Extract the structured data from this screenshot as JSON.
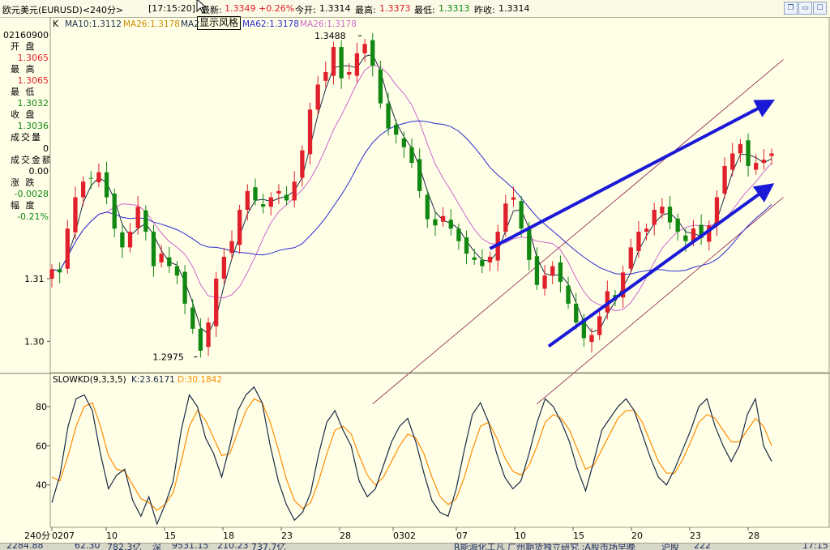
{
  "header": {
    "symbol": "欧元美元(EURUSD)<240分>",
    "time": "[17:15:20]",
    "latest_label": "最新:",
    "latest_value": "1.3349",
    "change_pct": "+0.26%",
    "open_label": "今开:",
    "open_value": "1.3314",
    "high_label": "最高:",
    "high_value": "1.3373",
    "low_label": "最低:",
    "low_value": "1.3313",
    "prev_label": "昨收:",
    "prev_value": "1.3314",
    "window_buttons": [
      "restore-icon",
      "minimize-icon",
      "maximize-icon",
      "close-icon"
    ]
  },
  "tooltip": "显示风格",
  "left_panel": {
    "code": "02160900",
    "rows": [
      {
        "label": "开 盘",
        "value": "1.3065",
        "color": "red"
      },
      {
        "label": "最 高",
        "value": "1.3065",
        "color": "red"
      },
      {
        "label": "最 低",
        "value": "1.3032",
        "color": "green"
      },
      {
        "label": "收 盘",
        "value": "1.3036",
        "color": "green"
      },
      {
        "label": "成交量",
        "value": "0",
        "color": "black"
      },
      {
        "label": "成交金额",
        "value": "0.00",
        "color": "black"
      },
      {
        "label": "涨 跌",
        "value": "-0.0028",
        "color": "green"
      },
      {
        "label": "幅 度",
        "value": "-0.21%",
        "color": "green"
      }
    ]
  },
  "status_bar": {
    "items": [
      "2284.88",
      "62.30",
      "782.3亿",
      "深",
      "9531.15",
      "210.23",
      "737.7亿",
      "R能源化工凡 广州期货独立研究 :A股市场早晚",
      "沪股",
      "222"
    ],
    "time": "17:15"
  },
  "colors": {
    "background": "#ffffe8",
    "up_candle": "#e0202a",
    "down_candle": "#118811",
    "ma10": "#1a2a44",
    "ma26": "#cc66cc",
    "ma62": "#2a2acc",
    "k_line": "#1a2a44",
    "d_line": "#ff8c00",
    "channel_arrow": "#1a1ad6",
    "trend_line": "#8b1a4a"
  },
  "chart_data": [
    {
      "type": "candlestick",
      "indicator_label": "K",
      "legend": [
        {
          "name": "MA10:1.3112",
          "color": "#1a2a44"
        },
        {
          "name": "MA26:1.3178",
          "color": "#cc8a00"
        },
        {
          "name": "MA2",
          "color": "#1a2a44"
        },
        {
          "name": "MA62:1.3178",
          "color": "#2a2acc"
        },
        {
          "name": "MA26:1.3178",
          "color": "#cc66cc"
        }
      ],
      "y_ticks": [
        1.3,
        1.31
      ],
      "y_tick_labels": [
        "1.30",
        "1.31"
      ],
      "ylim": [
        1.295,
        1.3505
      ],
      "x_labels": [
        "0207",
        "10",
        "15",
        "18",
        "23",
        "28",
        "0302",
        "07",
        "10",
        "15",
        "20",
        "23",
        "28"
      ],
      "period_label": "240分",
      "annotations": [
        {
          "text": "1.3488",
          "value": 1.3488
        },
        {
          "text": "1.2975",
          "value": 1.2975
        }
      ],
      "close_path": [
        1.3115,
        1.311,
        1.318,
        1.323,
        1.3255,
        1.326,
        1.327,
        1.323,
        1.318,
        1.315,
        1.3175,
        1.3215,
        1.3175,
        1.312,
        1.314,
        1.312,
        1.3105,
        1.306,
        1.302,
        1.2985,
        1.303,
        1.31,
        1.3135,
        1.316,
        1.321,
        1.324,
        1.3225,
        1.3215,
        1.323,
        1.324,
        1.3225,
        1.3255,
        1.3305,
        1.337,
        1.341,
        1.343,
        1.347,
        1.342,
        1.343,
        1.346,
        1.3475,
        1.344,
        1.338,
        1.334,
        1.333,
        1.331,
        1.3285,
        1.324,
        1.3195,
        1.3185,
        1.32,
        1.318,
        1.316,
        1.314,
        1.313,
        1.312,
        1.3135,
        1.3175,
        1.322,
        1.323,
        1.318,
        1.313,
        1.309,
        1.3105,
        1.312,
        1.3095,
        1.306,
        1.303,
        1.3005,
        1.301,
        1.304,
        1.308,
        1.307,
        1.311,
        1.315,
        1.3175,
        1.318,
        1.321,
        1.3215,
        1.319,
        1.3175,
        1.316,
        1.318,
        1.3165,
        1.3185,
        1.323,
        1.328,
        1.33,
        1.3315,
        1.328,
        1.3285,
        1.329,
        1.33
      ]
    },
    {
      "type": "line",
      "indicator_label": "SLOWKD(9,3,3,5)",
      "legend": [
        {
          "name": "K:23.6171",
          "color": "#1a2a44"
        },
        {
          "name": "D:30.1842",
          "color": "#ff8c00"
        }
      ],
      "y_ticks": [
        40,
        60,
        80
      ],
      "ylim": [
        20,
        92
      ],
      "series": [
        {
          "name": "K",
          "values": [
            31,
            45,
            70,
            84,
            86,
            78,
            56,
            38,
            45,
            48,
            32,
            24,
            34,
            20,
            30,
            42,
            68,
            86,
            80,
            64,
            56,
            44,
            60,
            78,
            86,
            90,
            82,
            60,
            42,
            30,
            22,
            26,
            36,
            56,
            72,
            78,
            68,
            60,
            42,
            34,
            38,
            50,
            62,
            70,
            74,
            62,
            46,
            32,
            26,
            24,
            38,
            58,
            76,
            82,
            72,
            56,
            44,
            38,
            42,
            56,
            72,
            84,
            80,
            72,
            62,
            48,
            37,
            52,
            68,
            74,
            80,
            84,
            78,
            66,
            54,
            44,
            40,
            48,
            58,
            68,
            80,
            84,
            70,
            60,
            52,
            60,
            76,
            84,
            60,
            52
          ]
        },
        {
          "name": "D",
          "values": [
            44,
            42,
            55,
            70,
            80,
            82,
            70,
            55,
            48,
            47,
            40,
            33,
            31,
            27,
            30,
            36,
            52,
            70,
            78,
            73,
            64,
            55,
            56,
            67,
            78,
            84,
            82,
            72,
            58,
            43,
            32,
            28,
            31,
            42,
            56,
            68,
            70,
            66,
            55,
            45,
            40,
            44,
            52,
            60,
            66,
            64,
            56,
            44,
            34,
            30,
            33,
            44,
            58,
            70,
            72,
            64,
            54,
            47,
            45,
            50,
            60,
            72,
            76,
            74,
            68,
            58,
            48,
            50,
            58,
            66,
            74,
            78,
            78,
            72,
            62,
            52,
            46,
            46,
            53,
            62,
            72,
            76,
            74,
            68,
            62,
            62,
            68,
            74,
            70,
            60
          ]
        }
      ]
    }
  ]
}
